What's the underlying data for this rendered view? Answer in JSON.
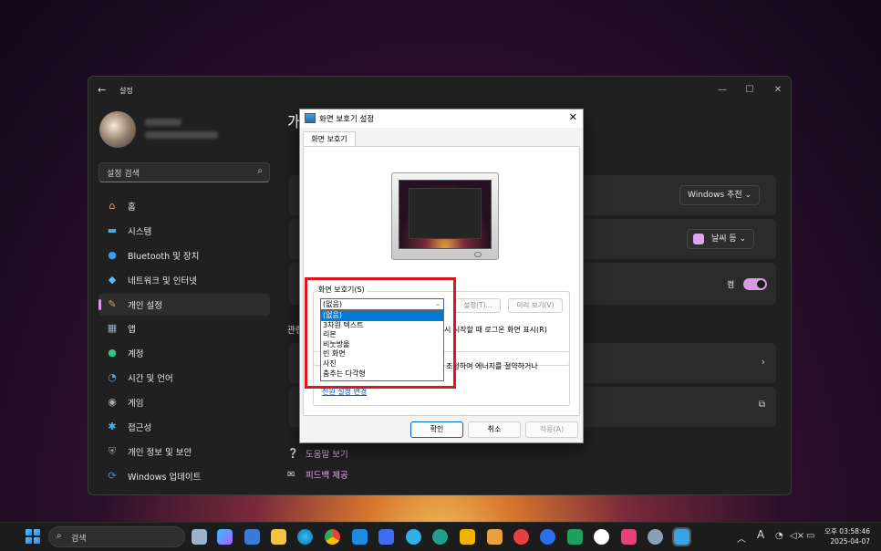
{
  "settings": {
    "title": "설정",
    "search_placeholder": "설정 검색",
    "page_title": "개",
    "nav": [
      {
        "label": "홈",
        "icon": "home-icon",
        "color": "#e8a66a"
      },
      {
        "label": "시스템",
        "icon": "monitor-icon",
        "color": "#4aa8e8"
      },
      {
        "label": "Bluetooth 및 장치",
        "icon": "bluetooth-icon",
        "color": "#3b9cf0"
      },
      {
        "label": "네트워크 및 인터넷",
        "icon": "wifi-icon",
        "color": "#5bb8f5"
      },
      {
        "label": "개인 설정",
        "icon": "brush-icon",
        "color": "#e89c4c"
      },
      {
        "label": "앱",
        "icon": "apps-icon",
        "color": "#9aa8c8"
      },
      {
        "label": "계정",
        "icon": "person-icon",
        "color": "#3cc08a"
      },
      {
        "label": "시간 및 언어",
        "icon": "globe-clock-icon",
        "color": "#5aa0e0"
      },
      {
        "label": "게임",
        "icon": "gamepad-icon",
        "color": "#aaaaaa"
      },
      {
        "label": "접근성",
        "icon": "accessibility-icon",
        "color": "#4ab0f0"
      },
      {
        "label": "개인 정보 및 보안",
        "icon": "shield-icon",
        "color": "#9a9a9a"
      },
      {
        "label": "Windows 업데이트",
        "icon": "update-icon",
        "color": "#3a8ee0"
      }
    ],
    "active_nav": "개인 설정",
    "cards": {
      "windows_recommend": "Windows 추천",
      "weather": "날씨 등",
      "toggle_label": "켬",
      "section_label": "관련"
    },
    "links": {
      "help": "도움말 보기",
      "feedback": "피드백 제공"
    }
  },
  "dialog": {
    "title": "화면 보호기 설정",
    "tab": "화면 보호기",
    "group_label": "화면 보호기(S)",
    "selected": "(없음)",
    "options": [
      "(없음)",
      "3차원 텍스트",
      "리본",
      "비눗방울",
      "빈 화면",
      "사진",
      "춤추는 다각형"
    ],
    "settings_btn": "설정(T)...",
    "preview_btn": "미리 보기(V)",
    "resume_text": "시 시작할 때 로그온 화면 표시(R)",
    "power_text": "조정하여 에너지를 절약하거나",
    "power_link": "전원 설정 변경",
    "ok": "확인",
    "cancel": "취소",
    "apply": "적용(A)"
  },
  "taskbar": {
    "search": "검색",
    "time": "오후 03:58:46",
    "date": "2025-04-07",
    "ime": "A"
  }
}
